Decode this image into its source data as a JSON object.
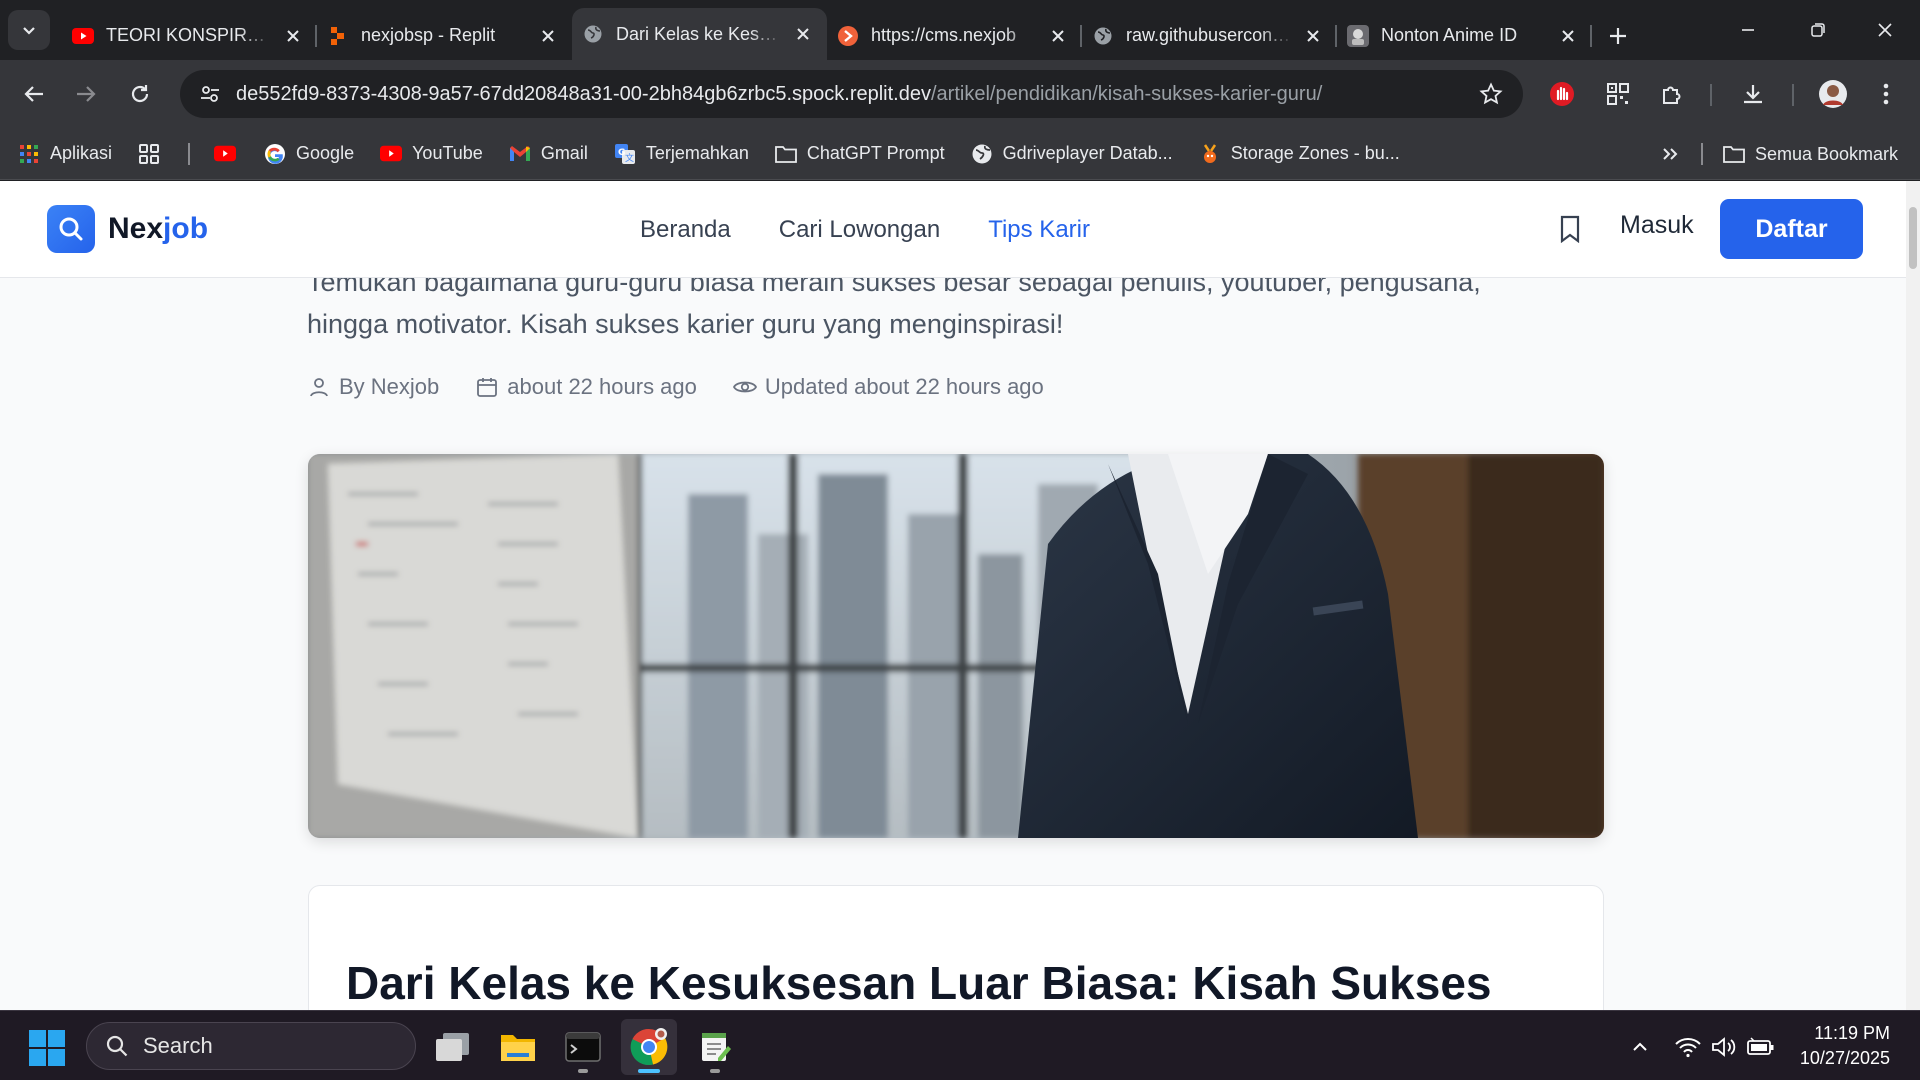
{
  "tabs": [
    {
      "title": "TEORI KONSPIRASI",
      "favicon": "youtube-icon"
    },
    {
      "title": "nexjobsp - Replit",
      "favicon": "replit-icon"
    },
    {
      "title": "Dari Kelas ke Kesuksesan",
      "favicon": "globe-icon",
      "active": true
    },
    {
      "title": "https://cms.nexjob",
      "favicon": "cms-icon"
    },
    {
      "title": "raw.githubusercontent",
      "favicon": "globe-icon"
    },
    {
      "title": "Nonton Anime ID",
      "favicon": "anime-icon"
    }
  ],
  "omnibox": {
    "host": "de552fd9-8373-4308-9a57-67dd20848a31-00-2bh84gb6zrbc5.spock.replit.dev",
    "path": "/artikel/pendidikan/kisah-sukses-karier-guru/"
  },
  "bookmarks": {
    "items": [
      {
        "label": "Aplikasi",
        "icon": "apps-grid-icon"
      },
      {
        "label": "",
        "icon": "grid-icon"
      },
      {
        "label": "",
        "icon": "youtube-icon"
      },
      {
        "label": "Google",
        "icon": "google-icon"
      },
      {
        "label": "YouTube",
        "icon": "youtube-icon"
      },
      {
        "label": "Gmail",
        "icon": "gmail-icon"
      },
      {
        "label": "Terjemahkan",
        "icon": "translate-icon"
      },
      {
        "label": "ChatGPT Prompt",
        "icon": "folder-icon"
      },
      {
        "label": "Gdriveplayer Datab...",
        "icon": "globe-icon"
      },
      {
        "label": "Storage Zones - bu...",
        "icon": "bunny-icon"
      }
    ],
    "all_label": "Semua Bookmark"
  },
  "site": {
    "logo_main": "Nex",
    "logo_accent": "job",
    "nav": [
      "Beranda",
      "Cari Lowongan",
      "Tips Karir"
    ],
    "active_nav": "Tips Karir",
    "login": "Masuk",
    "register": "Daftar"
  },
  "article": {
    "excerpt_line1": "Temukan bagaimana guru-guru biasa meraih sukses besar sebagai penulis, youtuber, pengusaha,",
    "excerpt_line2": "hingga motivator. Kisah sukses karier guru yang menginspirasi!",
    "author": "By Nexjob",
    "published": "about 22 hours ago",
    "updated": "Updated about 22 hours ago",
    "title": "Dari Kelas ke Kesuksesan Luar Biasa: Kisah Sukses"
  },
  "taskbar": {
    "search_placeholder": "Search",
    "time": "11:19 PM",
    "date": "10/27/2025"
  },
  "colors": {
    "accent": "#2563eb",
    "chrome_dark": "#202124",
    "chrome_toolbar": "#35363a",
    "page_bg": "#f9fafb"
  }
}
